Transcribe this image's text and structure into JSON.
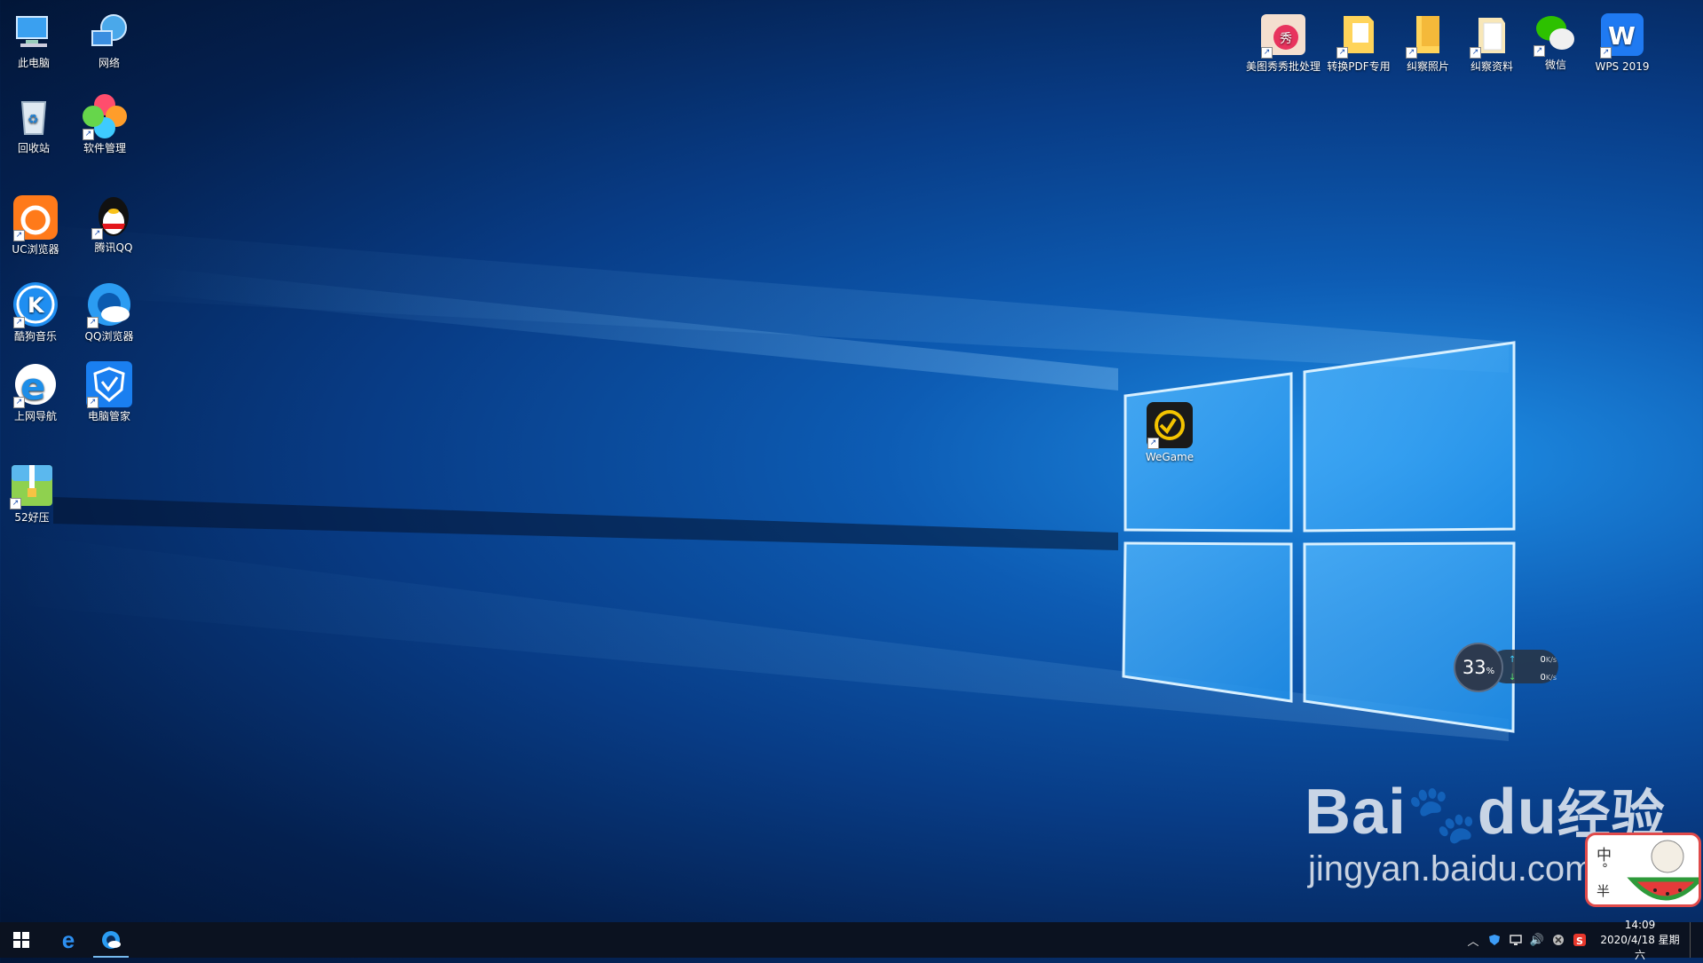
{
  "desktop": {
    "left_icons": [
      {
        "name": "this-pc",
        "label": "此电脑",
        "icon": "computer-icon"
      },
      {
        "name": "network",
        "label": "网络",
        "icon": "network-globe-icon"
      },
      {
        "name": "recycle-bin",
        "label": "回收站",
        "icon": "recycle-bin-icon"
      },
      {
        "name": "software-manager",
        "label": "软件管理",
        "icon": "clover-icon"
      },
      {
        "name": "uc-browser",
        "label": "UC浏览器",
        "icon": "uc-browser-icon"
      },
      {
        "name": "tencent-qq",
        "label": "腾讯QQ",
        "icon": "qq-penguin-icon"
      },
      {
        "name": "kugou-music",
        "label": "酷狗音乐",
        "icon": "kugou-icon"
      },
      {
        "name": "qq-browser",
        "label": "QQ浏览器",
        "icon": "qq-browser-icon"
      },
      {
        "name": "web-nav",
        "label": "上网导航",
        "icon": "ie-e-icon"
      },
      {
        "name": "pc-manager",
        "label": "电脑管家",
        "icon": "shield-icon"
      },
      {
        "name": "52haoya",
        "label": "52好压",
        "icon": "zip-icon"
      }
    ],
    "top_icons": [
      {
        "name": "meitu-batch",
        "label": "美图秀秀批处理",
        "icon": "meitu-icon"
      },
      {
        "name": "pdf-convert",
        "label": "转换PDF专用",
        "icon": "folder-icon"
      },
      {
        "name": "photos",
        "label": "纠察照片",
        "icon": "folder-icon"
      },
      {
        "name": "materials",
        "label": "纠察资料",
        "icon": "folder-icon"
      },
      {
        "name": "wechat",
        "label": "微信",
        "icon": "wechat-icon"
      },
      {
        "name": "wps",
        "label": "WPS 2019",
        "icon": "wps-icon"
      }
    ],
    "center_icon": {
      "name": "wegame",
      "label": "WeGame",
      "icon": "wegame-icon"
    }
  },
  "net_widget": {
    "percent": "33",
    "percent_sign": "%",
    "upload": "0",
    "download": "0",
    "unit": "K/s"
  },
  "watermark": {
    "brand": "Bai",
    "brand_du": "du",
    "brand_cn": "经验",
    "url": "jingyan.baidu.com"
  },
  "ime": {
    "char": "中",
    "dot": "°",
    "half": "半"
  },
  "taskbar": {
    "start_icon": "windows-start-icon",
    "pinned": [
      {
        "name": "ie",
        "icon": "edge-e-icon"
      },
      {
        "name": "qq-browser",
        "icon": "qq-browser-icon"
      }
    ],
    "tray": [
      "chevron-up-icon",
      "shield-icon",
      "network-icon",
      "volume-icon",
      "close-circle-icon",
      "sogou-icon"
    ],
    "time": "14:09",
    "date": "2020/4/18 星期六"
  },
  "colors": {
    "accent": "#0e6fd6",
    "taskbar": "#0b1220",
    "watermark_red": "#e04a4a"
  }
}
